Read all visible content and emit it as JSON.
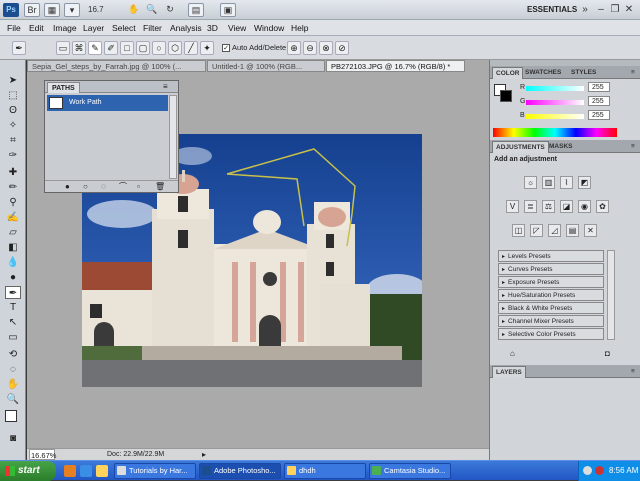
{
  "app": {
    "logo": "Ps",
    "zoom_level": "16.7",
    "workspace": "ESSENTIALS"
  },
  "menu": [
    "File",
    "Edit",
    "Image",
    "Layer",
    "Select",
    "Filter",
    "Analysis",
    "3D",
    "View",
    "Window",
    "Help"
  ],
  "options_bar": {
    "auto_add_delete": "Auto Add/Delete",
    "auto_add_checked": true
  },
  "documents": {
    "tabs": [
      "Sepia_Gel_steps_by_Farrah.jpg @ 100% (...",
      "Untitled-1 @ 100% (RGB...",
      "PB272103.JPG @ 16.7% (RGB/8) *"
    ],
    "active_tab": 2
  },
  "status": {
    "zoom": "16.67%",
    "doc_size": "Doc: 22.9M/22.9M"
  },
  "paths_panel": {
    "tab": "PATHS",
    "items": [
      "Work Path"
    ]
  },
  "color_panel": {
    "tabs": [
      "COLOR",
      "SWATCHES",
      "STYLES"
    ],
    "sliders": [
      {
        "label": "R",
        "value": "255"
      },
      {
        "label": "G",
        "value": "255"
      },
      {
        "label": "B",
        "value": "255"
      }
    ]
  },
  "adjustments_panel": {
    "tabs": [
      "ADJUSTMENTS",
      "MASKS"
    ],
    "title": "Add an adjustment",
    "presets": [
      "Levels Presets",
      "Curves Presets",
      "Exposure Presets",
      "Hue/Saturation Presets",
      "Black & White Presets",
      "Channel Mixer Presets",
      "Selective Color Presets"
    ]
  },
  "layers_panel": {
    "tab": "LAYERS"
  },
  "taskbar": {
    "start": "start",
    "tasks": [
      "Tutorials by Har...",
      "Adobe Photosho...",
      "dhdh",
      "Camtasia Studio..."
    ],
    "clock": "8:56 AM"
  },
  "colors": {
    "sky": "#2352a8",
    "path_stroke": "#c8c04a",
    "selected_row": "#2e63b0",
    "taskbar": "#245edb"
  }
}
